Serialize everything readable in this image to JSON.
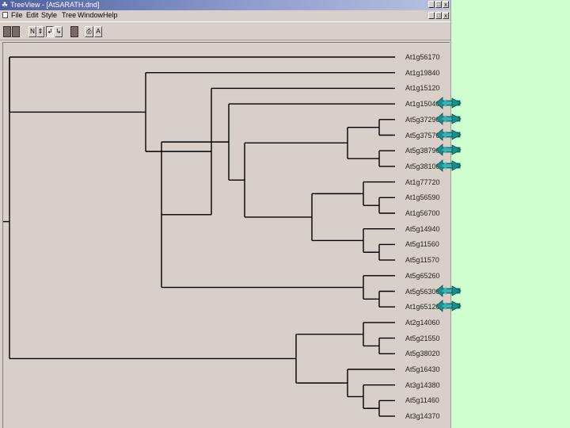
{
  "window": {
    "title": "TreeView - [AtSARATH.dnd]",
    "buttons": [
      "_",
      "□",
      "x"
    ]
  },
  "menu": {
    "items": [
      "File",
      "Edit",
      "Style",
      "Tree",
      "Window",
      "Help"
    ],
    "doc_buttons": [
      "_",
      "□",
      "x"
    ]
  },
  "toolbar": {
    "tools": [
      "",
      "",
      "N",
      "⇕",
      "↲",
      "↳",
      "",
      "⎙",
      "A"
    ]
  },
  "tree": {
    "leaves": [
      "At1g56170",
      "At1g19840",
      "At1g15120",
      "At1g15040",
      "At5g37290",
      "At5g37570",
      "At5g38790",
      "At5g38100",
      "At1g77720",
      "At1g56590",
      "At1g56700",
      "At5g14940",
      "At5g11560",
      "At5g11570",
      "At5g65260",
      "At5g56300",
      "At1g65120",
      "At2g14060",
      "At5g21550",
      "At5g38020",
      "At5g16430",
      "At3g14380",
      "At5g11460",
      "At3g14370"
    ],
    "marked_leaves": [
      3,
      4,
      5,
      6,
      7,
      15,
      16
    ],
    "arrow_color": "#1a8e8e",
    "branch_color": "#000000"
  }
}
